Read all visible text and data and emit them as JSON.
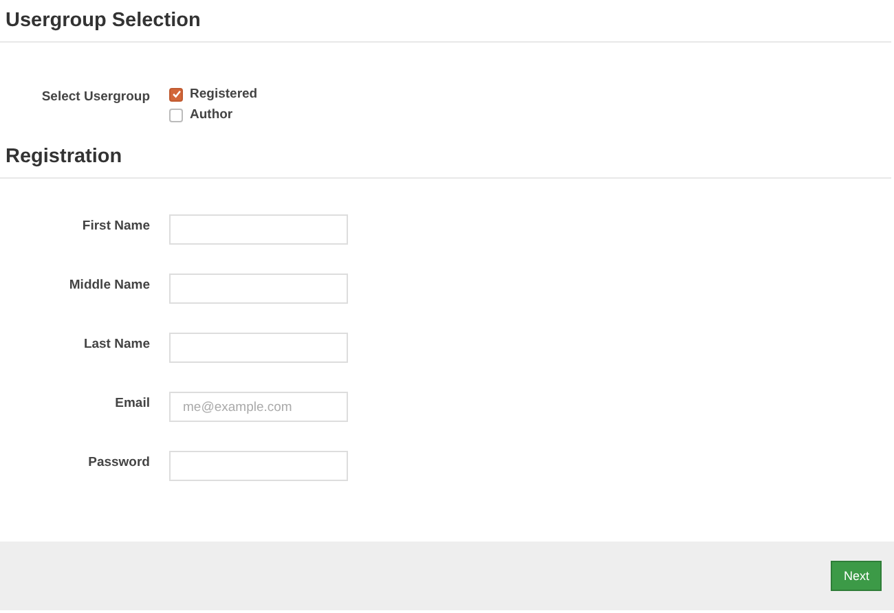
{
  "usergroup_section": {
    "title": "Usergroup Selection",
    "label": "Select Usergroup",
    "options": [
      {
        "label": "Registered",
        "checked": true
      },
      {
        "label": "Author",
        "checked": false
      }
    ]
  },
  "registration_section": {
    "title": "Registration",
    "fields": [
      {
        "label": "First Name"
      },
      {
        "label": "Middle Name"
      },
      {
        "label": "Last Name"
      },
      {
        "label": "Email",
        "placeholder": "me@example.com"
      },
      {
        "label": "Password"
      }
    ]
  },
  "footer": {
    "button": "Next"
  }
}
